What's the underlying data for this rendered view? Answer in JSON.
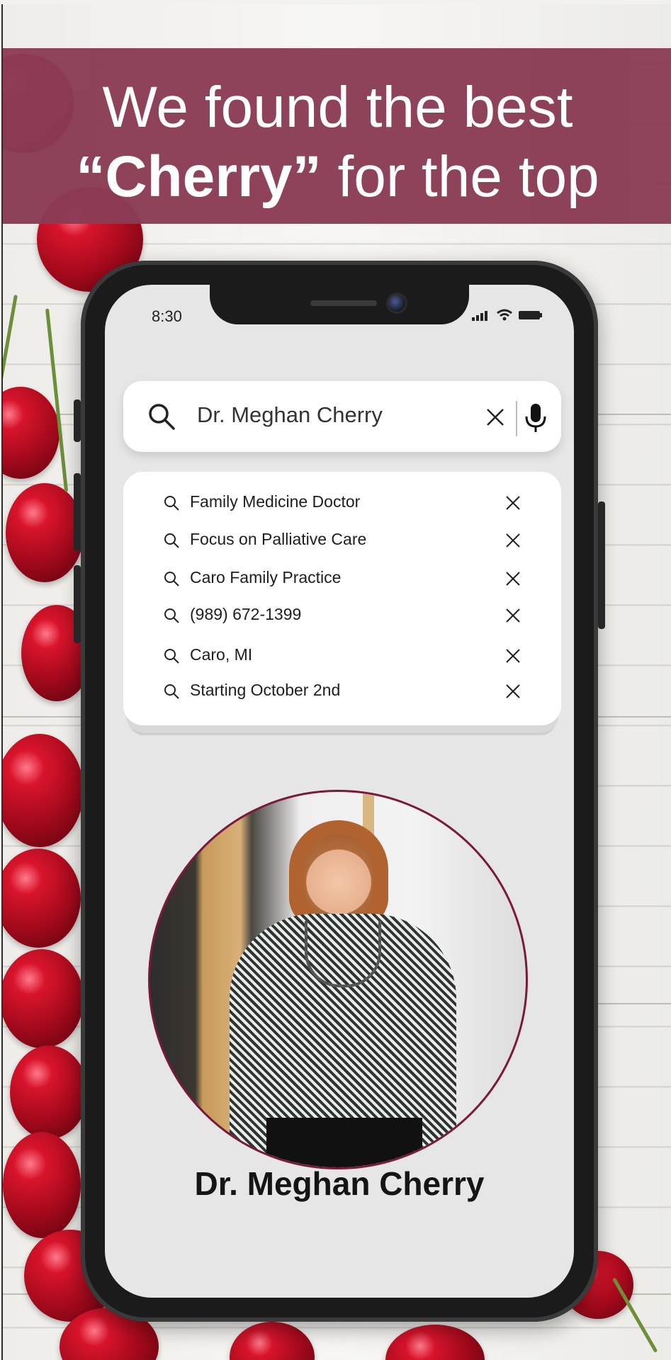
{
  "banner": {
    "line1": "We found the best",
    "line2_bold": "“Cherry”",
    "line2_rest": " for the top"
  },
  "status_bar": {
    "time": "8:30",
    "icons": [
      "signal-icon",
      "wifi-icon",
      "battery-icon"
    ]
  },
  "search": {
    "query": "Dr. Meghan Cherry",
    "icons": [
      "search-icon",
      "clear-icon",
      "microphone-icon"
    ]
  },
  "suggestions": [
    {
      "label": "Family Medicine Doctor"
    },
    {
      "label": "Focus on Palliative Care"
    },
    {
      "label": "Caro Family Practice"
    },
    {
      "label": "(989) 672-1399"
    },
    {
      "label": "Caro, MI"
    },
    {
      "label": "Starting October 2nd"
    }
  ],
  "profile": {
    "name": "Dr. Meghan Cherry"
  },
  "colors": {
    "banner": "#8a3c54",
    "portrait_border": "#7a1a3a",
    "screen": "#e6e6e6"
  }
}
